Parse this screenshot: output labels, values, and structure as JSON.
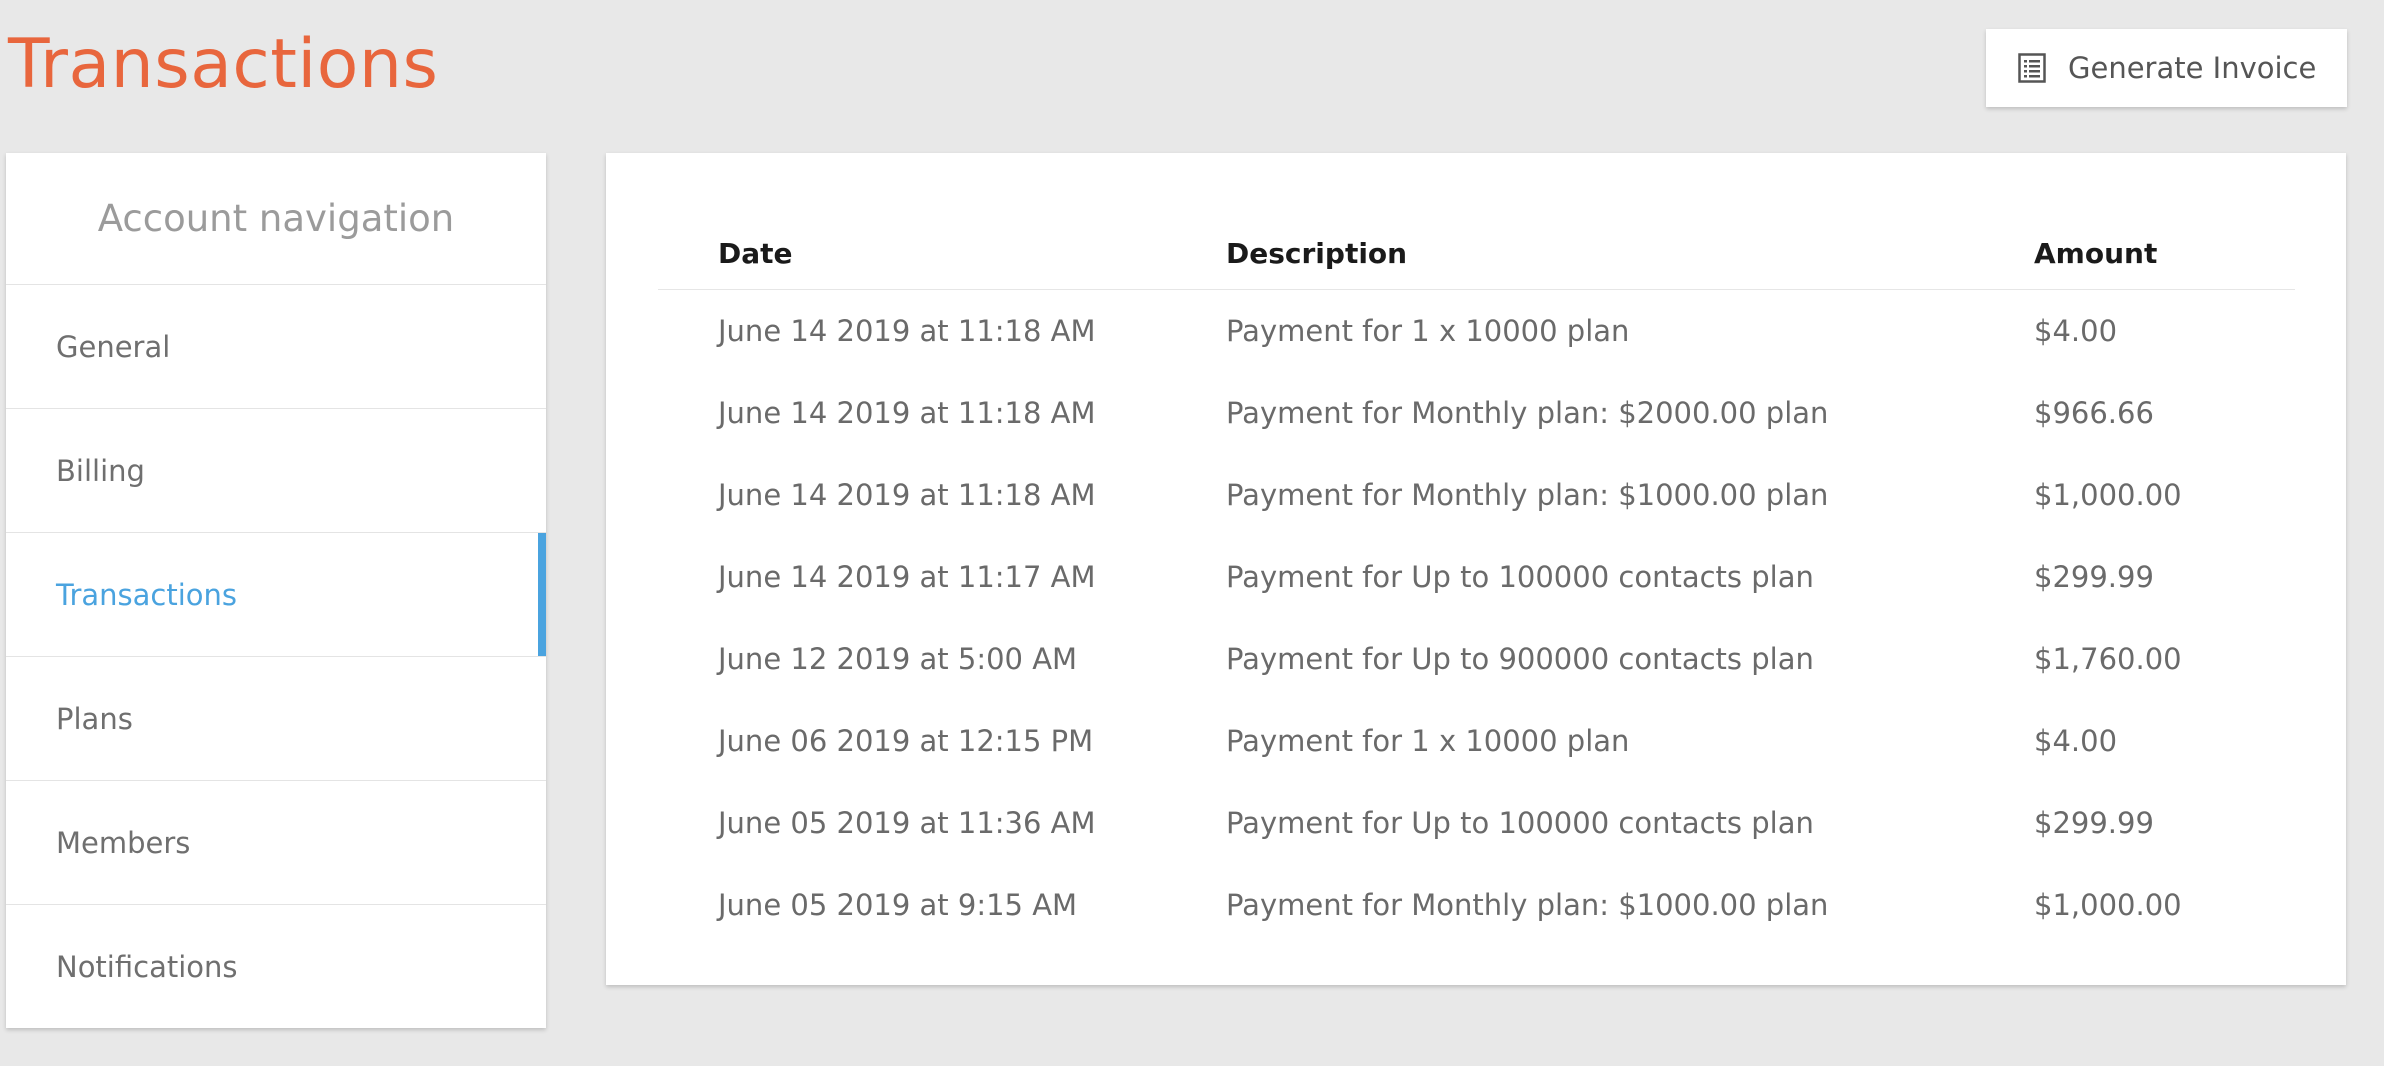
{
  "header": {
    "title": "Transactions",
    "generate_invoice_label": "Generate Invoice",
    "generate_invoice_icon": "invoice-list-icon"
  },
  "sidebar": {
    "title": "Account navigation",
    "items": [
      {
        "label": "General",
        "active": false
      },
      {
        "label": "Billing",
        "active": false
      },
      {
        "label": "Transactions",
        "active": true
      },
      {
        "label": "Plans",
        "active": false
      },
      {
        "label": "Members",
        "active": false
      },
      {
        "label": "Notifications",
        "active": false
      }
    ]
  },
  "table": {
    "headers": {
      "date": "Date",
      "description": "Description",
      "amount": "Amount"
    },
    "rows": [
      {
        "date": "June 14 2019 at 11:18 AM",
        "description": "Payment for 1 x 10000 plan",
        "amount": "$4.00"
      },
      {
        "date": "June 14 2019 at 11:18 AM",
        "description": "Payment for Monthly plan: $2000.00 plan",
        "amount": "$966.66"
      },
      {
        "date": "June 14 2019 at 11:18 AM",
        "description": "Payment for Monthly plan: $1000.00 plan",
        "amount": "$1,000.00"
      },
      {
        "date": "June 14 2019 at 11:17 AM",
        "description": "Payment for Up to 100000 contacts plan",
        "amount": "$299.99"
      },
      {
        "date": "June 12 2019 at 5:00 AM",
        "description": "Payment for Up to 900000 contacts plan",
        "amount": "$1,760.00"
      },
      {
        "date": "June 06 2019 at 12:15 PM",
        "description": "Payment for 1 x 10000 plan",
        "amount": "$4.00"
      },
      {
        "date": "June 05 2019 at 11:36 AM",
        "description": "Payment for Up to 100000 contacts plan",
        "amount": "$299.99"
      },
      {
        "date": "June 05 2019 at 9:15 AM",
        "description": "Payment for Monthly plan: $1000.00 plan",
        "amount": "$1,000.00"
      }
    ]
  },
  "colors": {
    "title": "#e8663d",
    "accent": "#4aa3df",
    "background": "#e8e8e8"
  }
}
